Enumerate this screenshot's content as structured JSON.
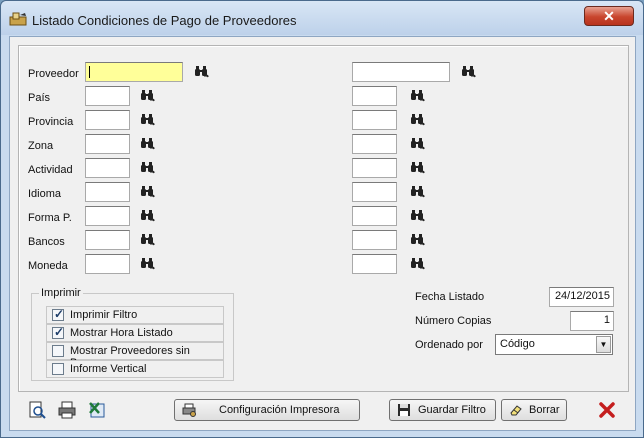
{
  "window": {
    "title": "Listado Condiciones de Pago de Proveedores",
    "close_glyph": "✕"
  },
  "filters": [
    {
      "label": "Proveedor",
      "from_value": "",
      "to_value": ""
    },
    {
      "label": "País",
      "from_value": "",
      "to_value": ""
    },
    {
      "label": "Provincia",
      "from_value": "",
      "to_value": ""
    },
    {
      "label": "Zona",
      "from_value": "",
      "to_value": ""
    },
    {
      "label": "Actividad",
      "from_value": "",
      "to_value": ""
    },
    {
      "label": "Idioma",
      "from_value": "",
      "to_value": ""
    },
    {
      "label": "Forma P.",
      "from_value": "",
      "to_value": ""
    },
    {
      "label": "Bancos",
      "from_value": "",
      "to_value": ""
    },
    {
      "label": "Moneda",
      "from_value": "",
      "to_value": ""
    }
  ],
  "print_group": {
    "title": "Imprimir",
    "options": [
      {
        "label": "Imprimir Filtro",
        "checked": true
      },
      {
        "label": "Mostrar Hora Listado",
        "checked": true
      },
      {
        "label": "Mostrar Proveedores sin Banco",
        "checked": false
      },
      {
        "label": "Informe Vertical",
        "checked": false
      }
    ]
  },
  "settings": {
    "fecha_label": "Fecha Listado",
    "fecha_value": "24/12/2015",
    "copias_label": "Número Copias",
    "copias_value": "1",
    "orden_label": "Ordenado por",
    "orden_value": "Código"
  },
  "buttons": {
    "config": "Configuración Impresora",
    "guardar": "Guardar Filtro",
    "borrar": "Borrar"
  },
  "icons": [
    "app-icon",
    "binoculars-icon",
    "print-preview-icon",
    "printer-icon",
    "excel-export-icon",
    "printer-config-icon",
    "floppy-disk-icon",
    "eraser-icon",
    "exit-icon"
  ]
}
